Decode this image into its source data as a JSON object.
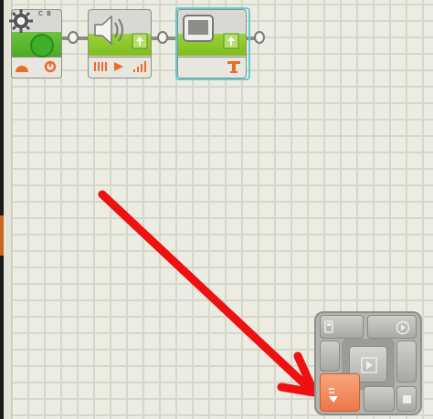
{
  "canvas": {
    "grid_color": "#d6d6ca",
    "background_color": "#ecece2"
  },
  "blocks": [
    {
      "name": "start-block",
      "label": "C B",
      "icons": [
        "gear-icon",
        "green-circle-icon",
        "motor-icon",
        "rotation-icon"
      ]
    },
    {
      "name": "sound-block",
      "icons": [
        "speaker-icon",
        "wave-icon",
        "play-icon",
        "volume-icon"
      ]
    },
    {
      "name": "display-block",
      "selected": true,
      "icons": [
        "screen-icon",
        "text-icon"
      ]
    }
  ],
  "annotation": {
    "type": "arrow",
    "color": "#ee1111",
    "direction": "down-right"
  },
  "navigator": {
    "buttons": [
      "nxt-icon",
      "play-circle-icon",
      "play-center-icon",
      "download-icon",
      "stop-icon"
    ],
    "highlighted": "download-icon",
    "highlight_color": "#ee7748"
  }
}
